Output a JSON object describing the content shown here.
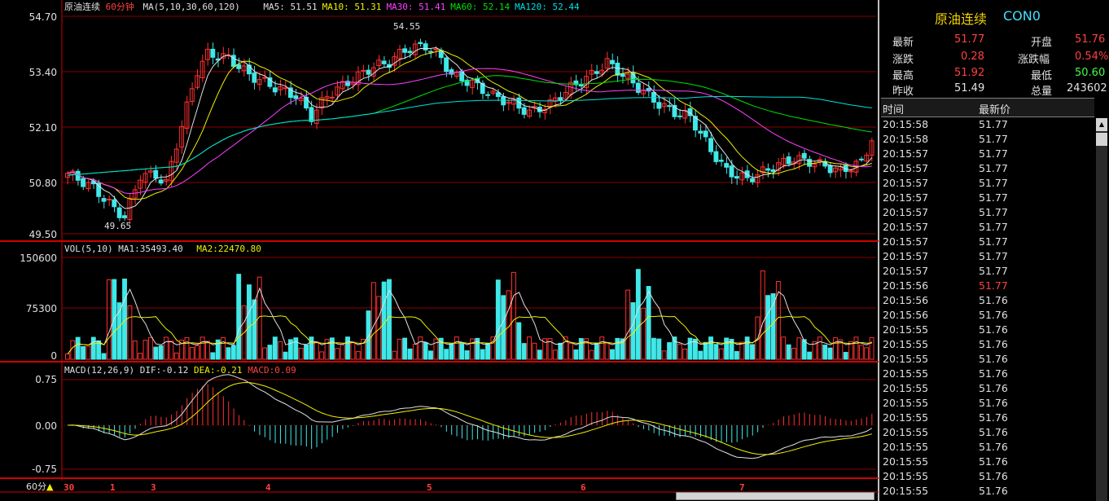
{
  "instrument": {
    "name": "原油连续",
    "code": "CON0"
  },
  "main_panel": {
    "title": "原油连续",
    "period": "60分钟",
    "ma_label": "MA(5,10,30,60,120)",
    "ma_values": [
      {
        "label": "MA5: 51.51",
        "color": "#e0e0e0"
      },
      {
        "label": "MA10: 51.31",
        "color": "#f0f000"
      },
      {
        "label": "MA30: 51.41",
        "color": "#ff40ff"
      },
      {
        "label": "MA60: 52.14",
        "color": "#00e000"
      },
      {
        "label": "MA120: 52.44",
        "color": "#00e0e0"
      }
    ],
    "y_ticks": [
      "54.70",
      "53.40",
      "52.10",
      "50.80",
      "49.50"
    ],
    "high_marker": "54.55",
    "low_marker": "49.65"
  },
  "volume_panel": {
    "label": "VOL(5,10)",
    "ma1": "MA1:35493.40",
    "ma2": "MA2:22470.80",
    "y_ticks": [
      "150600",
      "75300",
      "0"
    ]
  },
  "macd_panel": {
    "label": "MACD(12,26,9)",
    "dif": "DIF:-0.12",
    "dea": "DEA:-0.21",
    "macd": "MACD:0.09",
    "y_ticks": [
      "0.75",
      "0.00",
      "-0.75"
    ]
  },
  "date_axis": {
    "period_button": "60分",
    "labels": [
      "30",
      "1",
      "3",
      "4",
      "5",
      "6",
      "7"
    ]
  },
  "quote": {
    "latest_label": "最新",
    "latest": "51.77",
    "open_label": "开盘",
    "open": "51.76",
    "change_label": "涨跌",
    "change": "0.28",
    "change_pct_label": "涨跌幅",
    "change_pct": "0.54%",
    "high_label": "最高",
    "high": "51.92",
    "low_label": "最低",
    "low": "50.60",
    "prev_close_label": "昨收",
    "prev_close": "51.49",
    "volume_label": "总量",
    "volume": "243602"
  },
  "ticks": {
    "time_header": "时间",
    "price_header": "最新价",
    "rows": [
      {
        "time": "20:15:58",
        "price": "51.77",
        "color": "#e0e0e0"
      },
      {
        "time": "20:15:58",
        "price": "51.77",
        "color": "#e0e0e0"
      },
      {
        "time": "20:15:57",
        "price": "51.77",
        "color": "#e0e0e0"
      },
      {
        "time": "20:15:57",
        "price": "51.77",
        "color": "#e0e0e0"
      },
      {
        "time": "20:15:57",
        "price": "51.77",
        "color": "#e0e0e0"
      },
      {
        "time": "20:15:57",
        "price": "51.77",
        "color": "#e0e0e0"
      },
      {
        "time": "20:15:57",
        "price": "51.77",
        "color": "#e0e0e0"
      },
      {
        "time": "20:15:57",
        "price": "51.77",
        "color": "#e0e0e0"
      },
      {
        "time": "20:15:57",
        "price": "51.77",
        "color": "#e0e0e0"
      },
      {
        "time": "20:15:57",
        "price": "51.77",
        "color": "#e0e0e0"
      },
      {
        "time": "20:15:57",
        "price": "51.77",
        "color": "#e0e0e0"
      },
      {
        "time": "20:15:56",
        "price": "51.77",
        "color": "#ff4040"
      },
      {
        "time": "20:15:56",
        "price": "51.76",
        "color": "#e0e0e0"
      },
      {
        "time": "20:15:56",
        "price": "51.76",
        "color": "#e0e0e0"
      },
      {
        "time": "20:15:55",
        "price": "51.76",
        "color": "#e0e0e0"
      },
      {
        "time": "20:15:55",
        "price": "51.76",
        "color": "#e0e0e0"
      },
      {
        "time": "20:15:55",
        "price": "51.76",
        "color": "#e0e0e0"
      },
      {
        "time": "20:15:55",
        "price": "51.76",
        "color": "#e0e0e0"
      },
      {
        "time": "20:15:55",
        "price": "51.76",
        "color": "#e0e0e0"
      },
      {
        "time": "20:15:55",
        "price": "51.76",
        "color": "#e0e0e0"
      },
      {
        "time": "20:15:55",
        "price": "51.76",
        "color": "#e0e0e0"
      },
      {
        "time": "20:15:55",
        "price": "51.76",
        "color": "#e0e0e0"
      },
      {
        "time": "20:15:55",
        "price": "51.76",
        "color": "#e0e0e0"
      },
      {
        "time": "20:15:55",
        "price": "51.76",
        "color": "#e0e0e0"
      },
      {
        "time": "20:15:55",
        "price": "51.76",
        "color": "#e0e0e0"
      },
      {
        "time": "20:15:55",
        "price": "51.76",
        "color": "#e0e0e0"
      }
    ]
  },
  "colors": {
    "up": "#ff3030",
    "down": "#40e8e8",
    "grid": "#8b0000",
    "border": "#d00000",
    "ma5": "#e0e0e0",
    "ma10": "#f0f000",
    "ma30": "#ff40ff",
    "ma60": "#00e000",
    "ma120": "#00e0e0",
    "dif": "#e0e0e0",
    "dea": "#f0f000",
    "quote_label": "#e0e0e0",
    "quote_up": "#ff4040",
    "quote_down": "#40ff40",
    "title_yellow": "#f0d000",
    "title_cyan": "#40e0ff"
  }
}
